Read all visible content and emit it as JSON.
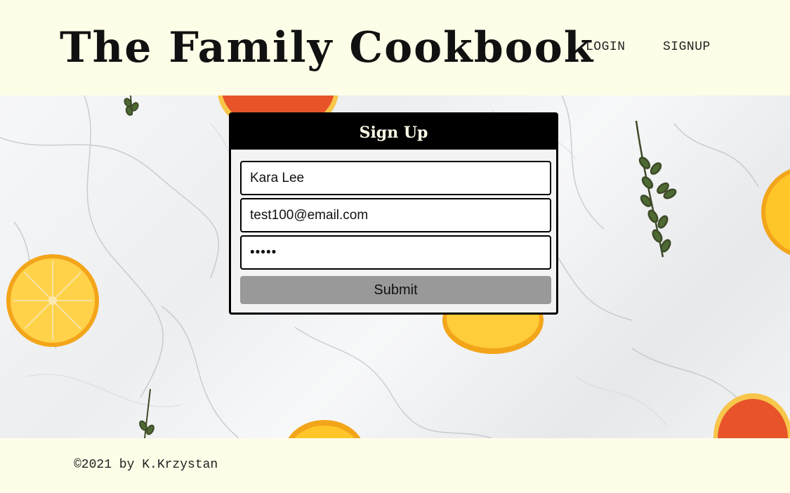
{
  "header": {
    "site_title": "The Family Cookbook",
    "nav": [
      {
        "label": "LOGIN"
      },
      {
        "label": "SIGNUP"
      }
    ]
  },
  "signup_form": {
    "title": "Sign Up",
    "username_value": "Kara Lee",
    "email_value": "test100@email.com",
    "password_value": "•••••",
    "submit_label": "Submit"
  },
  "footer": {
    "copyright": "©2021 by K.Krzystan"
  },
  "colors": {
    "page_background": "#fefee8",
    "card_header": "#000000",
    "submit_button": "#999999",
    "orange": "#f6b21a",
    "grapefruit": "#e8532a"
  },
  "decor": {
    "background_image": "marble-with-citrus-slices"
  }
}
